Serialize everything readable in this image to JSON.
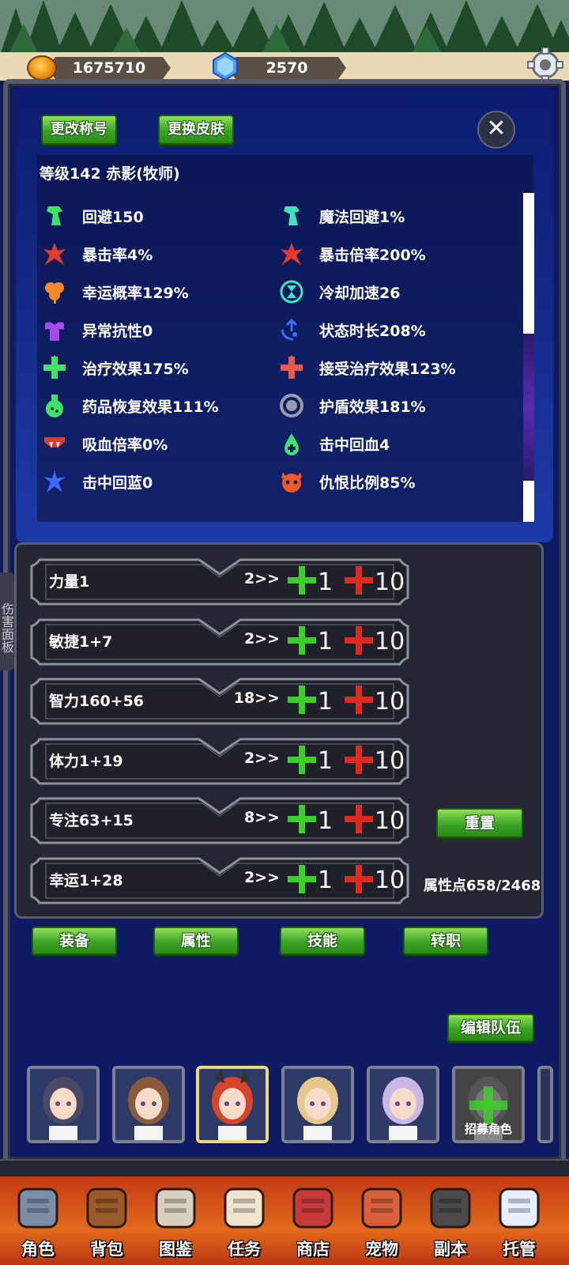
{
  "currency": {
    "gold": "1675710",
    "gems": "2570"
  },
  "header_buttons": {
    "change_title": "更改称号",
    "change_skin": "更换皮肤"
  },
  "character": {
    "title": "等级142   赤影(牧师)"
  },
  "stats_left": [
    {
      "label": "回避150",
      "icon": "dodge-icon",
      "color": "#3ee36a"
    },
    {
      "label": "暴击率4%",
      "icon": "crit-rate-icon",
      "color": "#e83a2a"
    },
    {
      "label": "幸运概率129%",
      "icon": "clover-icon",
      "color": "#f08a2a"
    },
    {
      "label": "异常抗性0",
      "icon": "muscle-icon",
      "color": "#a64bea"
    },
    {
      "label": "治疗效果175%",
      "icon": "heal-cross-icon",
      "color": "#3ee36a"
    },
    {
      "label": "药品恢复效果111%",
      "icon": "potion-icon",
      "color": "#3ee36a"
    },
    {
      "label": "吸血倍率0%",
      "icon": "fangs-icon",
      "color": "#e83a2a"
    },
    {
      "label": "击中回蓝0",
      "icon": "mana-splash-icon",
      "color": "#3a6aff"
    }
  ],
  "stats_right": [
    {
      "label": "魔法回避1%",
      "icon": "magic-dodge-icon",
      "color": "#3ee3c0"
    },
    {
      "label": "暴击倍率200%",
      "icon": "crit-multiplier-icon",
      "color": "#e83a2a"
    },
    {
      "label": "冷却加速26",
      "icon": "hourglass-icon",
      "color": "#3ee3c0"
    },
    {
      "label": "状态时长208%",
      "icon": "duration-icon",
      "color": "#3a6aff"
    },
    {
      "label": "接受治疗效果123%",
      "icon": "receive-heal-icon",
      "color": "#e85a4a"
    },
    {
      "label": "护盾效果181%",
      "icon": "shield-icon",
      "color": "#9a9aa8"
    },
    {
      "label": "击中回血4",
      "icon": "blood-drop-icon",
      "color": "#3ee36a"
    },
    {
      "label": "仇恨比例85%",
      "icon": "demon-face-icon",
      "color": "#f05a2a"
    }
  ],
  "attributes": [
    {
      "name": "力量1",
      "cost": "2>>",
      "plus1": "1",
      "plus10": "10"
    },
    {
      "name": "敏捷1+7",
      "cost": "2>>",
      "plus1": "1",
      "plus10": "10"
    },
    {
      "name": "智力160+56",
      "cost": "18>>",
      "plus1": "1",
      "plus10": "10"
    },
    {
      "name": "体力1+19",
      "cost": "2>>",
      "plus1": "1",
      "plus10": "10"
    },
    {
      "name": "专注63+15",
      "cost": "8>>",
      "plus1": "1",
      "plus10": "10"
    },
    {
      "name": "幸运1+28",
      "cost": "2>>",
      "plus1": "1",
      "plus10": "10"
    }
  ],
  "reset_label": "重置",
  "attribute_points": "属性点658/2468",
  "side_tab": "伤害面板",
  "tabs": [
    "装备",
    "属性",
    "技能",
    "转职"
  ],
  "edit_team": "编辑队伍",
  "recruit_label": "招募角色",
  "nav": [
    "角色",
    "背包",
    "图鉴",
    "任务",
    "商店",
    "宠物",
    "副本",
    "托管"
  ]
}
